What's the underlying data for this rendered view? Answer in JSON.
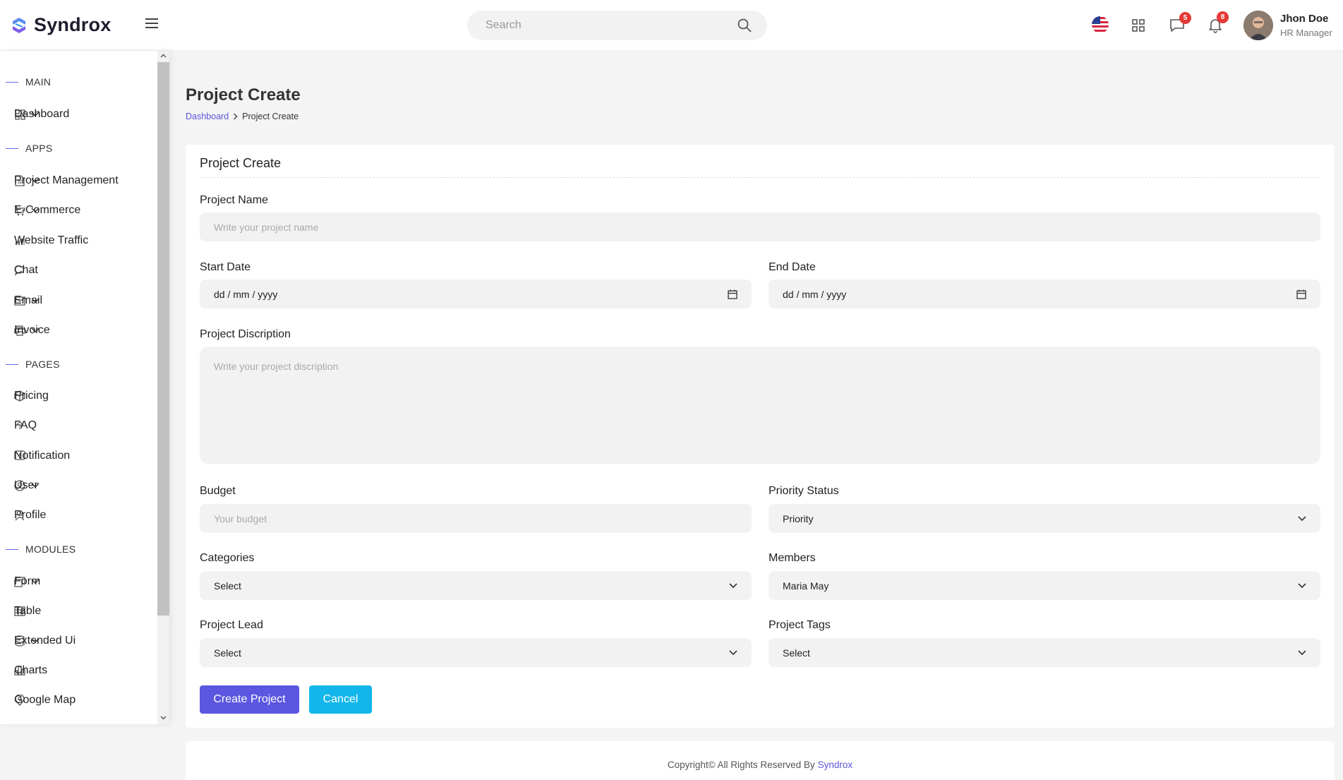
{
  "header": {
    "logo_text": "Syndrox",
    "search_placeholder": "Search",
    "messages_count": "5",
    "notifications_count": "8",
    "user_name": "Jhon Doe",
    "user_role": "HR Manager"
  },
  "sidebar": {
    "sections": {
      "main": "MAIN",
      "apps": "APPS",
      "pages": "PAGES",
      "modules": "MODULES"
    },
    "items": {
      "dashboard": "Dashboard",
      "project_management": "Project Management",
      "ecommerce": "E-Commerce",
      "website_traffic": "Website Traffic",
      "chat": "Chat",
      "email": "Email",
      "invoice": "Invoice",
      "pricing": "Pricing",
      "faq": "FAQ",
      "notification": "Notification",
      "user": "User",
      "profile": "Profile",
      "form": "Form",
      "table": "Table",
      "extended_ui": "Extended Ui",
      "charts": "Charts",
      "google_map": "Google Map"
    }
  },
  "page": {
    "title": "Project Create",
    "breadcrumb_home": "Dashboard",
    "breadcrumb_current": "Project Create"
  },
  "form": {
    "card_title": "Project Create",
    "project_name_label": "Project Name",
    "project_name_placeholder": "Write your project name",
    "start_date_label": "Start Date",
    "start_date_value": "dd / mm / yyyy",
    "end_date_label": "End Date",
    "end_date_value": "dd / mm / yyyy",
    "description_label": "Project Discription",
    "description_placeholder": "Write your project discription",
    "budget_label": "Budget",
    "budget_placeholder": "Your budget",
    "priority_label": "Priority Status",
    "priority_value": "Priority",
    "categories_label": "Categories",
    "categories_value": "Select",
    "members_label": "Members",
    "members_value": "Maria May",
    "lead_label": "Project Lead",
    "lead_value": "Select",
    "tags_label": "Project Tags",
    "tags_value": "Select",
    "create_button": "Create Project",
    "cancel_button": "Cancel"
  },
  "footer": {
    "text": "Copyright© All Rights Reserved By",
    "brand": "Syndrox"
  },
  "colors": {
    "primary": "#5b57e0",
    "info": "#12b6ea",
    "badge": "#e53935",
    "section_line": "#6466f1"
  }
}
